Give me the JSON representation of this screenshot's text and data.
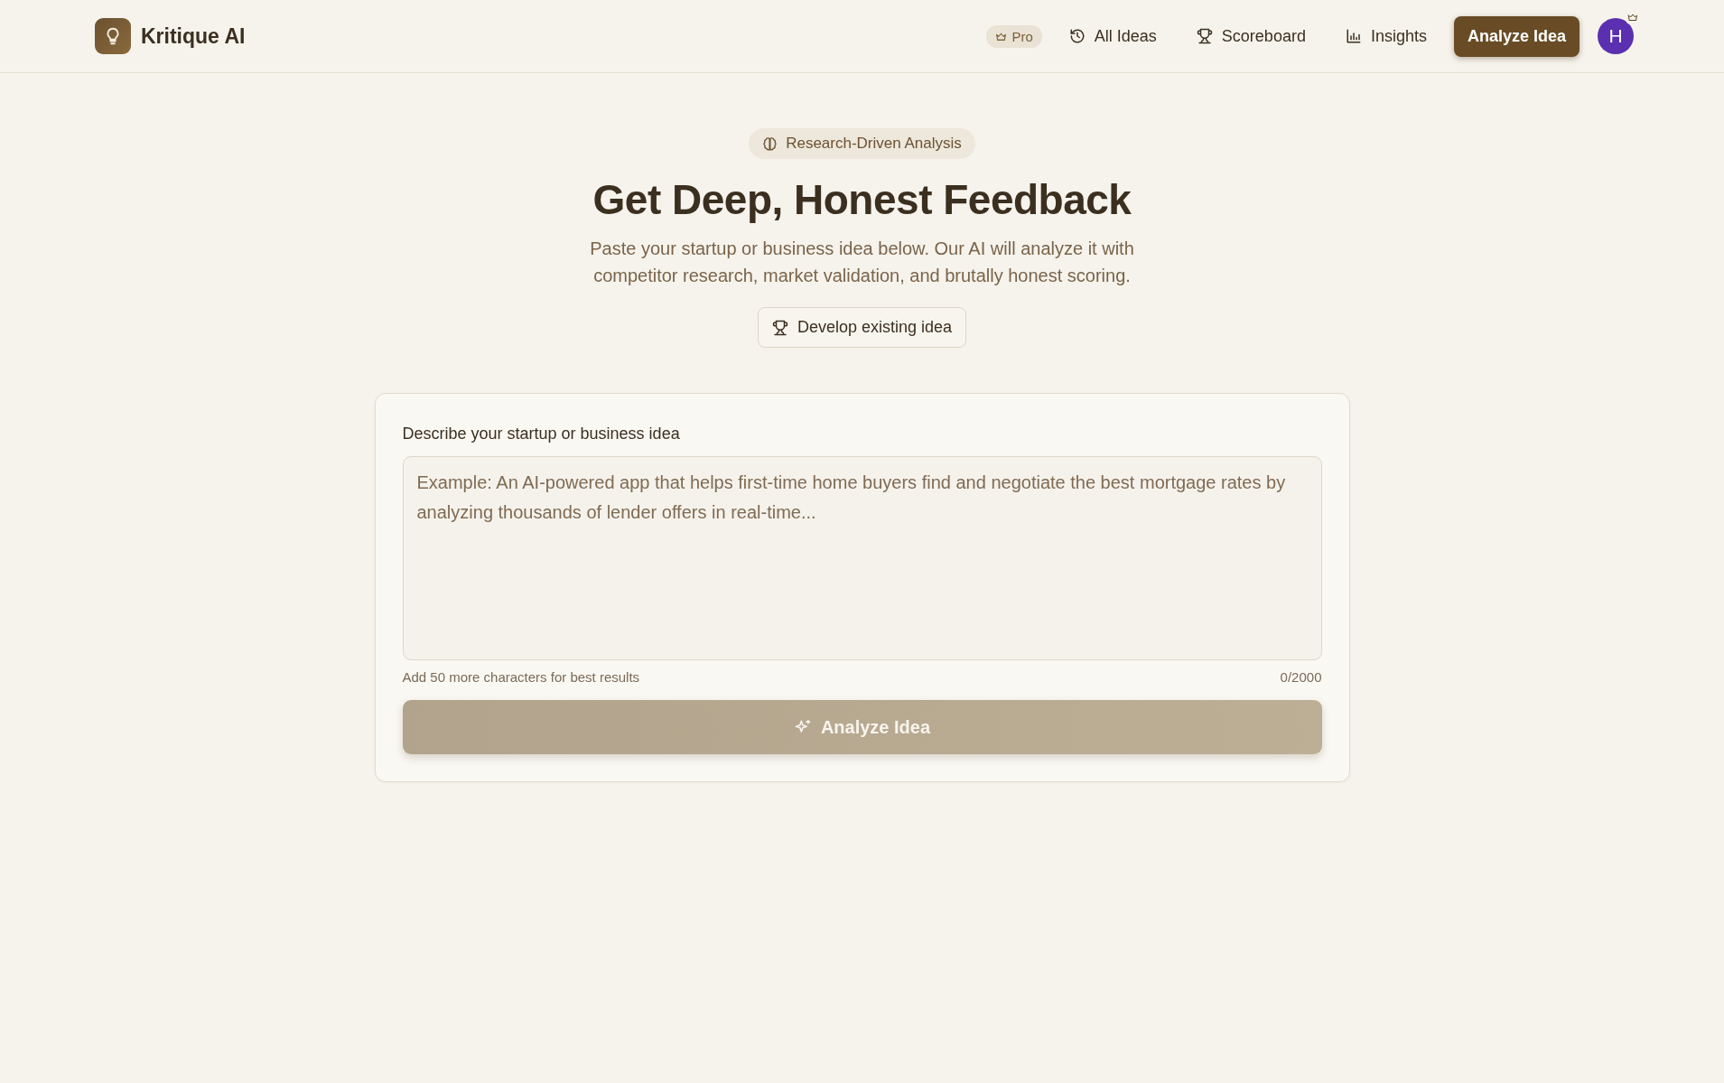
{
  "header": {
    "brand": "Kritique AI",
    "plan_badge": "Pro",
    "nav": [
      {
        "label": "All Ideas"
      },
      {
        "label": "Scoreboard"
      },
      {
        "label": "Insights"
      }
    ],
    "cta": "Analyze Idea",
    "avatar": {
      "initial": "H",
      "crown": true
    }
  },
  "hero": {
    "badge": "Research-Driven Analysis",
    "title": "Get Deep, Honest Feedback",
    "subtitle": "Paste your startup or business idea below. Our AI will analyze it with competitor research, market validation, and brutally honest scoring.",
    "secondary_button": "Develop existing idea"
  },
  "form": {
    "label": "Describe your startup or business idea",
    "placeholder": "Example: An AI-powered app that helps first-time home buyers find and negotiate the best mortgage rates by analyzing thousands of lender offers in real-time...",
    "hint": "Add 50 more characters for best results",
    "counter": "0/2000",
    "submit": {
      "label": "Analyze Idea",
      "disabled": true
    }
  }
}
